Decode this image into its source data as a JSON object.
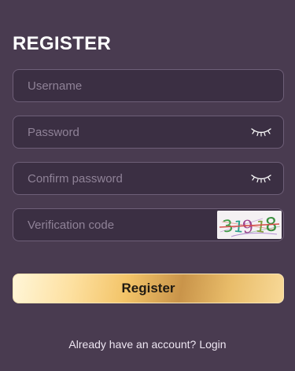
{
  "page": {
    "title": "REGISTER"
  },
  "form": {
    "username": {
      "placeholder": "Username",
      "value": ""
    },
    "password": {
      "placeholder": "Password",
      "value": "",
      "toggle_icon": "eye-closed-icon"
    },
    "confirm_password": {
      "placeholder": "Confirm password",
      "value": "",
      "toggle_icon": "eye-closed-icon"
    },
    "verification_code": {
      "placeholder": "Verification code",
      "value": "",
      "captcha_text": "31918"
    },
    "submit_label": "Register"
  },
  "footer": {
    "prompt": "Already have an account?",
    "login_label": "Login"
  },
  "colors": {
    "background": "#493b50",
    "field_background": "#3b2f43",
    "field_border": "#6e5f78",
    "placeholder": "#8f8297",
    "button_gold": "#f3c468"
  }
}
